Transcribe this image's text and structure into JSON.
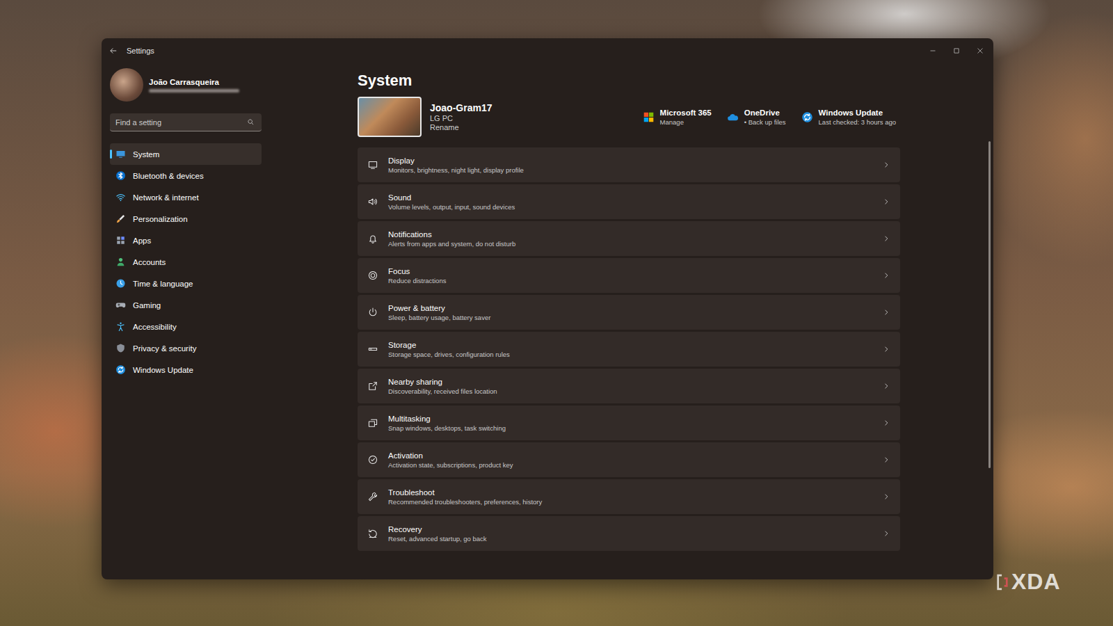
{
  "window": {
    "title": "Settings"
  },
  "profile": {
    "name": "João Carrasqueira"
  },
  "search": {
    "placeholder": "Find a setting"
  },
  "sidebar": {
    "items": [
      {
        "label": "System",
        "selected": true
      },
      {
        "label": "Bluetooth & devices",
        "selected": false
      },
      {
        "label": "Network & internet",
        "selected": false
      },
      {
        "label": "Personalization",
        "selected": false
      },
      {
        "label": "Apps",
        "selected": false
      },
      {
        "label": "Accounts",
        "selected": false
      },
      {
        "label": "Time & language",
        "selected": false
      },
      {
        "label": "Gaming",
        "selected": false
      },
      {
        "label": "Accessibility",
        "selected": false
      },
      {
        "label": "Privacy & security",
        "selected": false
      },
      {
        "label": "Windows Update",
        "selected": false
      }
    ]
  },
  "page": {
    "title": "System"
  },
  "device": {
    "name": "Joao-Gram17",
    "model": "LG PC",
    "action": "Rename"
  },
  "quick_links": [
    {
      "title": "Microsoft 365",
      "subtitle": "Manage"
    },
    {
      "title": "OneDrive",
      "subtitle": "• Back up files"
    },
    {
      "title": "Windows Update",
      "subtitle": "Last checked: 3 hours ago"
    }
  ],
  "settings": [
    {
      "title": "Display",
      "subtitle": "Monitors, brightness, night light, display profile"
    },
    {
      "title": "Sound",
      "subtitle": "Volume levels, output, input, sound devices"
    },
    {
      "title": "Notifications",
      "subtitle": "Alerts from apps and system, do not disturb"
    },
    {
      "title": "Focus",
      "subtitle": "Reduce distractions"
    },
    {
      "title": "Power & battery",
      "subtitle": "Sleep, battery usage, battery saver"
    },
    {
      "title": "Storage",
      "subtitle": "Storage space, drives, configuration rules"
    },
    {
      "title": "Nearby sharing",
      "subtitle": "Discoverability, received files location"
    },
    {
      "title": "Multitasking",
      "subtitle": "Snap windows, desktops, task switching"
    },
    {
      "title": "Activation",
      "subtitle": "Activation state, subscriptions, product key"
    },
    {
      "title": "Troubleshoot",
      "subtitle": "Recommended troubleshooters, preferences, history"
    },
    {
      "title": "Recovery",
      "subtitle": "Reset, advanced startup, go back"
    }
  ],
  "watermark": {
    "text": "XDA"
  }
}
